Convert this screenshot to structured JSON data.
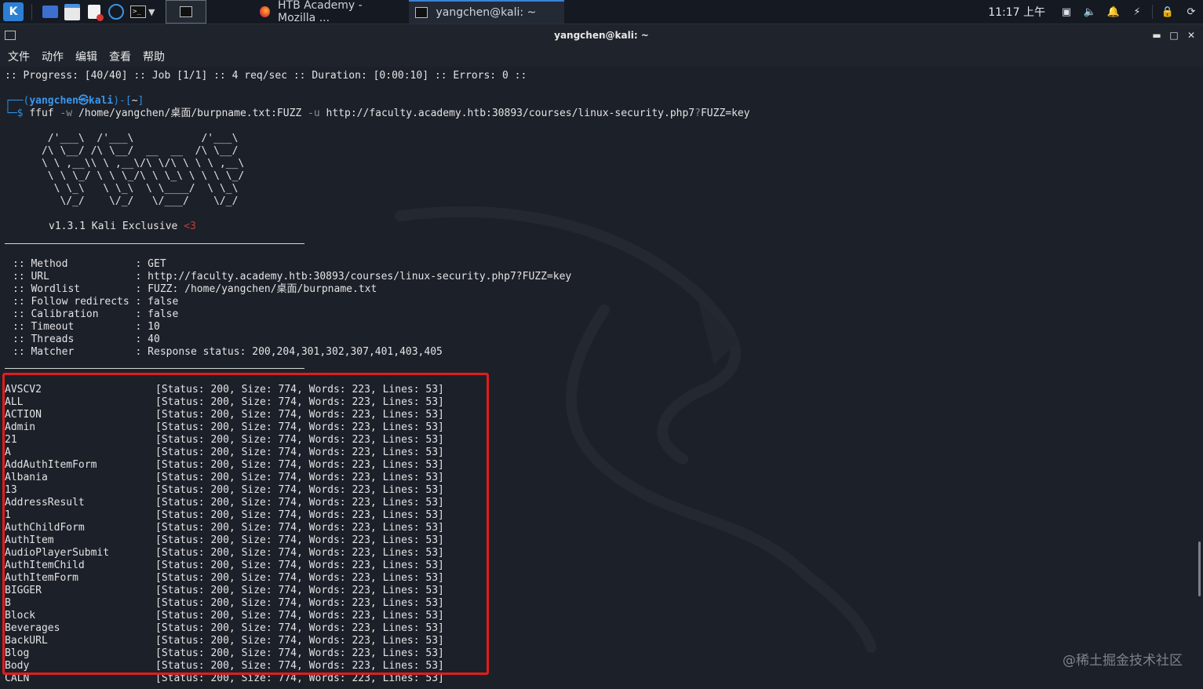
{
  "taskbar": {
    "launcher_icons": [
      "kali-menu-icon",
      "workspace-icon",
      "file-manager-icon",
      "text-editor-icon",
      "browser-icon",
      "terminal-icon"
    ],
    "tasks": [
      {
        "label": "HTB Academy - Mozilla ..."
      },
      {
        "label": "yangchen@kali: ~"
      }
    ],
    "clock": "11:17 上午"
  },
  "window": {
    "title": "yangchen@kali: ~",
    "menu": [
      "文件",
      "动作",
      "编辑",
      "查看",
      "帮助"
    ]
  },
  "terminal": {
    "progress_line": ":: Progress: [40/40] :: Job [1/1] :: 4 req/sec :: Duration: [0:00:10] :: Errors: 0 ::",
    "prompt_user": "yangchen㉿kali",
    "prompt_dir": "~",
    "command_name": "ffuf",
    "command_flag_w": "-w",
    "command_wordlist": "/home/yangchen/桌面/burpname.txt:FUZZ",
    "command_flag_u": "-u",
    "command_url_a": "http://faculty.academy.htb:30893/courses/linux-security.php7",
    "command_url_q": "?",
    "command_url_b": "FUZZ=key",
    "banner": [
      "       /'___\\  /'___\\           /'___\\       ",
      "      /\\ \\__/ /\\ \\__/  __  __  /\\ \\__/       ",
      "      \\ \\ ,__\\\\ \\ ,__\\/\\ \\/\\ \\ \\ \\ ,__\\      ",
      "       \\ \\ \\_/ \\ \\ \\_/\\ \\ \\_\\ \\ \\ \\ \\_/      ",
      "        \\ \\_\\   \\ \\_\\  \\ \\____/  \\ \\_\\       ",
      "         \\/_/    \\/_/   \\/___/    \\/_/       "
    ],
    "version": "v1.3.1 Kali Exclusive",
    "version_heart": "<3",
    "config": [
      ":: Method           : GET",
      ":: URL              : http://faculty.academy.htb:30893/courses/linux-security.php7?FUZZ=key",
      ":: Wordlist         : FUZZ: /home/yangchen/桌面/burpname.txt",
      ":: Follow redirects : false",
      ":: Calibration      : false",
      ":: Timeout          : 10",
      ":: Threads          : 40",
      ":: Matcher          : Response status: 200,204,301,302,307,401,403,405"
    ],
    "results": [
      {
        "word": "AVSCV2",
        "info": "[Status: 200, Size: 774, Words: 223, Lines: 53]"
      },
      {
        "word": "ALL",
        "info": "[Status: 200, Size: 774, Words: 223, Lines: 53]"
      },
      {
        "word": "ACTION",
        "info": "[Status: 200, Size: 774, Words: 223, Lines: 53]"
      },
      {
        "word": "Admin",
        "info": "[Status: 200, Size: 774, Words: 223, Lines: 53]"
      },
      {
        "word": "21",
        "info": "[Status: 200, Size: 774, Words: 223, Lines: 53]"
      },
      {
        "word": "A",
        "info": "[Status: 200, Size: 774, Words: 223, Lines: 53]"
      },
      {
        "word": "AddAuthItemForm",
        "info": "[Status: 200, Size: 774, Words: 223, Lines: 53]"
      },
      {
        "word": "Albania",
        "info": "[Status: 200, Size: 774, Words: 223, Lines: 53]"
      },
      {
        "word": "13",
        "info": "[Status: 200, Size: 774, Words: 223, Lines: 53]"
      },
      {
        "word": "AddressResult",
        "info": "[Status: 200, Size: 774, Words: 223, Lines: 53]"
      },
      {
        "word": "1",
        "info": "[Status: 200, Size: 774, Words: 223, Lines: 53]"
      },
      {
        "word": "AuthChildForm",
        "info": "[Status: 200, Size: 774, Words: 223, Lines: 53]"
      },
      {
        "word": "AuthItem",
        "info": "[Status: 200, Size: 774, Words: 223, Lines: 53]"
      },
      {
        "word": "AudioPlayerSubmit",
        "info": "[Status: 200, Size: 774, Words: 223, Lines: 53]"
      },
      {
        "word": "AuthItemChild",
        "info": "[Status: 200, Size: 774, Words: 223, Lines: 53]"
      },
      {
        "word": "AuthItemForm",
        "info": "[Status: 200, Size: 774, Words: 223, Lines: 53]"
      },
      {
        "word": "BIGGER",
        "info": "[Status: 200, Size: 774, Words: 223, Lines: 53]"
      },
      {
        "word": "B",
        "info": "[Status: 200, Size: 774, Words: 223, Lines: 53]"
      },
      {
        "word": "Block",
        "info": "[Status: 200, Size: 774, Words: 223, Lines: 53]"
      },
      {
        "word": "Beverages",
        "info": "[Status: 200, Size: 774, Words: 223, Lines: 53]"
      },
      {
        "word": "BackURL",
        "info": "[Status: 200, Size: 774, Words: 223, Lines: 53]"
      },
      {
        "word": "Blog",
        "info": "[Status: 200, Size: 774, Words: 223, Lines: 53]"
      },
      {
        "word": "Body",
        "info": "[Status: 200, Size: 774, Words: 223, Lines: 53]"
      },
      {
        "word": "CALN",
        "info": "[Status: 200, Size: 774, Words: 223, Lines: 53]"
      }
    ]
  },
  "watermark": "@稀土掘金技术社区",
  "colors": {
    "highlight": "#e01d1d",
    "prompt": "#2f8fe0",
    "background": "#1c2029"
  }
}
